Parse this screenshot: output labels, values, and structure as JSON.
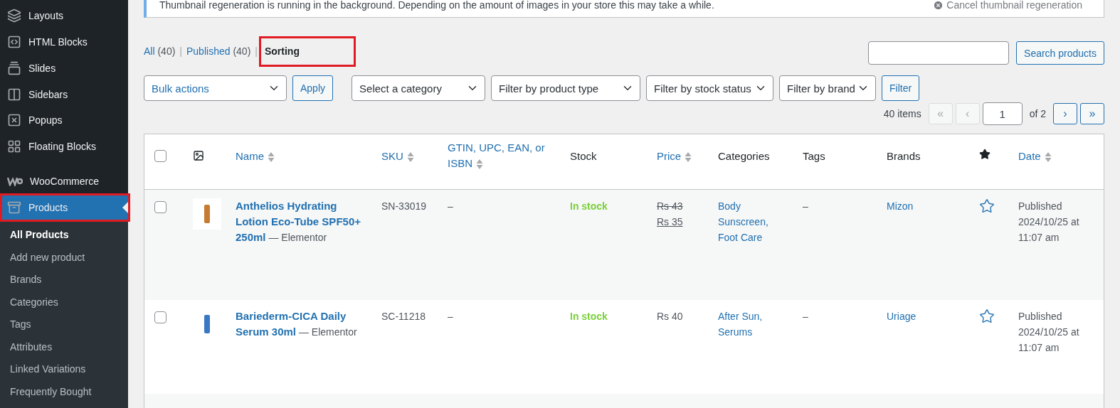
{
  "sidebar": {
    "items": [
      {
        "label": "Layouts",
        "selected": false,
        "highlighted": false
      },
      {
        "label": "HTML Blocks",
        "selected": false,
        "highlighted": false
      },
      {
        "label": "Slides",
        "selected": false,
        "highlighted": false
      },
      {
        "label": "Sidebars",
        "selected": false,
        "highlighted": false
      },
      {
        "label": "Popups",
        "selected": false,
        "highlighted": false
      },
      {
        "label": "Floating Blocks",
        "selected": false,
        "highlighted": false
      },
      {
        "label": "WooCommerce",
        "selected": false,
        "highlighted": false
      },
      {
        "label": "Products",
        "selected": true,
        "highlighted": true
      }
    ],
    "submenu": [
      {
        "label": "All Products",
        "selected": true
      },
      {
        "label": "Add new product",
        "selected": false
      },
      {
        "label": "Brands",
        "selected": false
      },
      {
        "label": "Categories",
        "selected": false
      },
      {
        "label": "Tags",
        "selected": false
      },
      {
        "label": "Attributes",
        "selected": false
      },
      {
        "label": "Linked Variations",
        "selected": false
      },
      {
        "label": "Frequently Bought",
        "selected": false
      }
    ]
  },
  "notice": {
    "message": "Thumbnail regeneration is running in the background. Depending on the amount of images in your store this may take a while.",
    "action": "Cancel thumbnail regeneration"
  },
  "views": [
    {
      "label": "All",
      "count": "(40)",
      "selected": false,
      "highlighted": false
    },
    {
      "label": "Published",
      "count": "(40)",
      "selected": false,
      "highlighted": false
    },
    {
      "label": "Sorting",
      "selected": true,
      "highlighted": true
    }
  ],
  "view_separator": "|",
  "search": {
    "button": "Search products"
  },
  "bulk_actions": {
    "value": "Bulk actions",
    "button": "Apply"
  },
  "filters": [
    "Select a category",
    "Filter by product type",
    "Filter by stock status",
    "Filter by brand"
  ],
  "filter_button": "Filter",
  "pagination": {
    "items": "40 items",
    "first": "«",
    "prev": "‹",
    "page": "1",
    "of": "of 2",
    "next": "›",
    "last": "»",
    "first_disabled": true,
    "prev_disabled": true,
    "next_disabled": false,
    "last_disabled": false
  },
  "table": {
    "select_all_checked": false,
    "columns": [
      {
        "kind": "check"
      },
      {
        "kind": "thumb"
      },
      {
        "kind": "text",
        "label": "Name",
        "sortable": true
      },
      {
        "kind": "text",
        "label": "SKU",
        "sortable": true
      },
      {
        "kind": "text",
        "label": "GTIN, UPC, EAN, or ISBN",
        "sortable": true
      },
      {
        "kind": "text",
        "label": "Stock",
        "sortable": false
      },
      {
        "kind": "text",
        "label": "Price",
        "sortable": true
      },
      {
        "kind": "text",
        "label": "Categories",
        "sortable": false
      },
      {
        "kind": "text",
        "label": "Tags",
        "sortable": false
      },
      {
        "kind": "text",
        "label": "Brands",
        "sortable": false
      },
      {
        "kind": "featured"
      },
      {
        "kind": "text",
        "label": "Date",
        "sortable": true
      }
    ],
    "rows": [
      {
        "checked": false,
        "name": "Anthelios Hydrating Lotion Eco-Tube SPF50+ 250ml",
        "builder": "— Elementor",
        "sku": "SN-33019",
        "gtin": "–",
        "stock": "In stock",
        "regular_price": "Rs 43",
        "sale_price": "Rs 35",
        "categories": [
          "Body Sunscreen,",
          "Foot Care"
        ],
        "tags": "–",
        "brand": "Mizon",
        "featured": false,
        "date_status": "Published",
        "date": "2024/10/25 at 11:07 am"
      },
      {
        "checked": false,
        "name": "Bariederm-CICA Daily Serum 30ml",
        "builder": "— Elementor",
        "sku": "SC-11218",
        "gtin": "–",
        "stock": "In stock",
        "regular_price": "Rs 40",
        "categories": [
          "After Sun,",
          "Serums"
        ],
        "tags": "–",
        "brand": "Uriage",
        "featured": false,
        "date_status": "Published",
        "date": "2024/10/25 at 11:07 am"
      }
    ]
  }
}
